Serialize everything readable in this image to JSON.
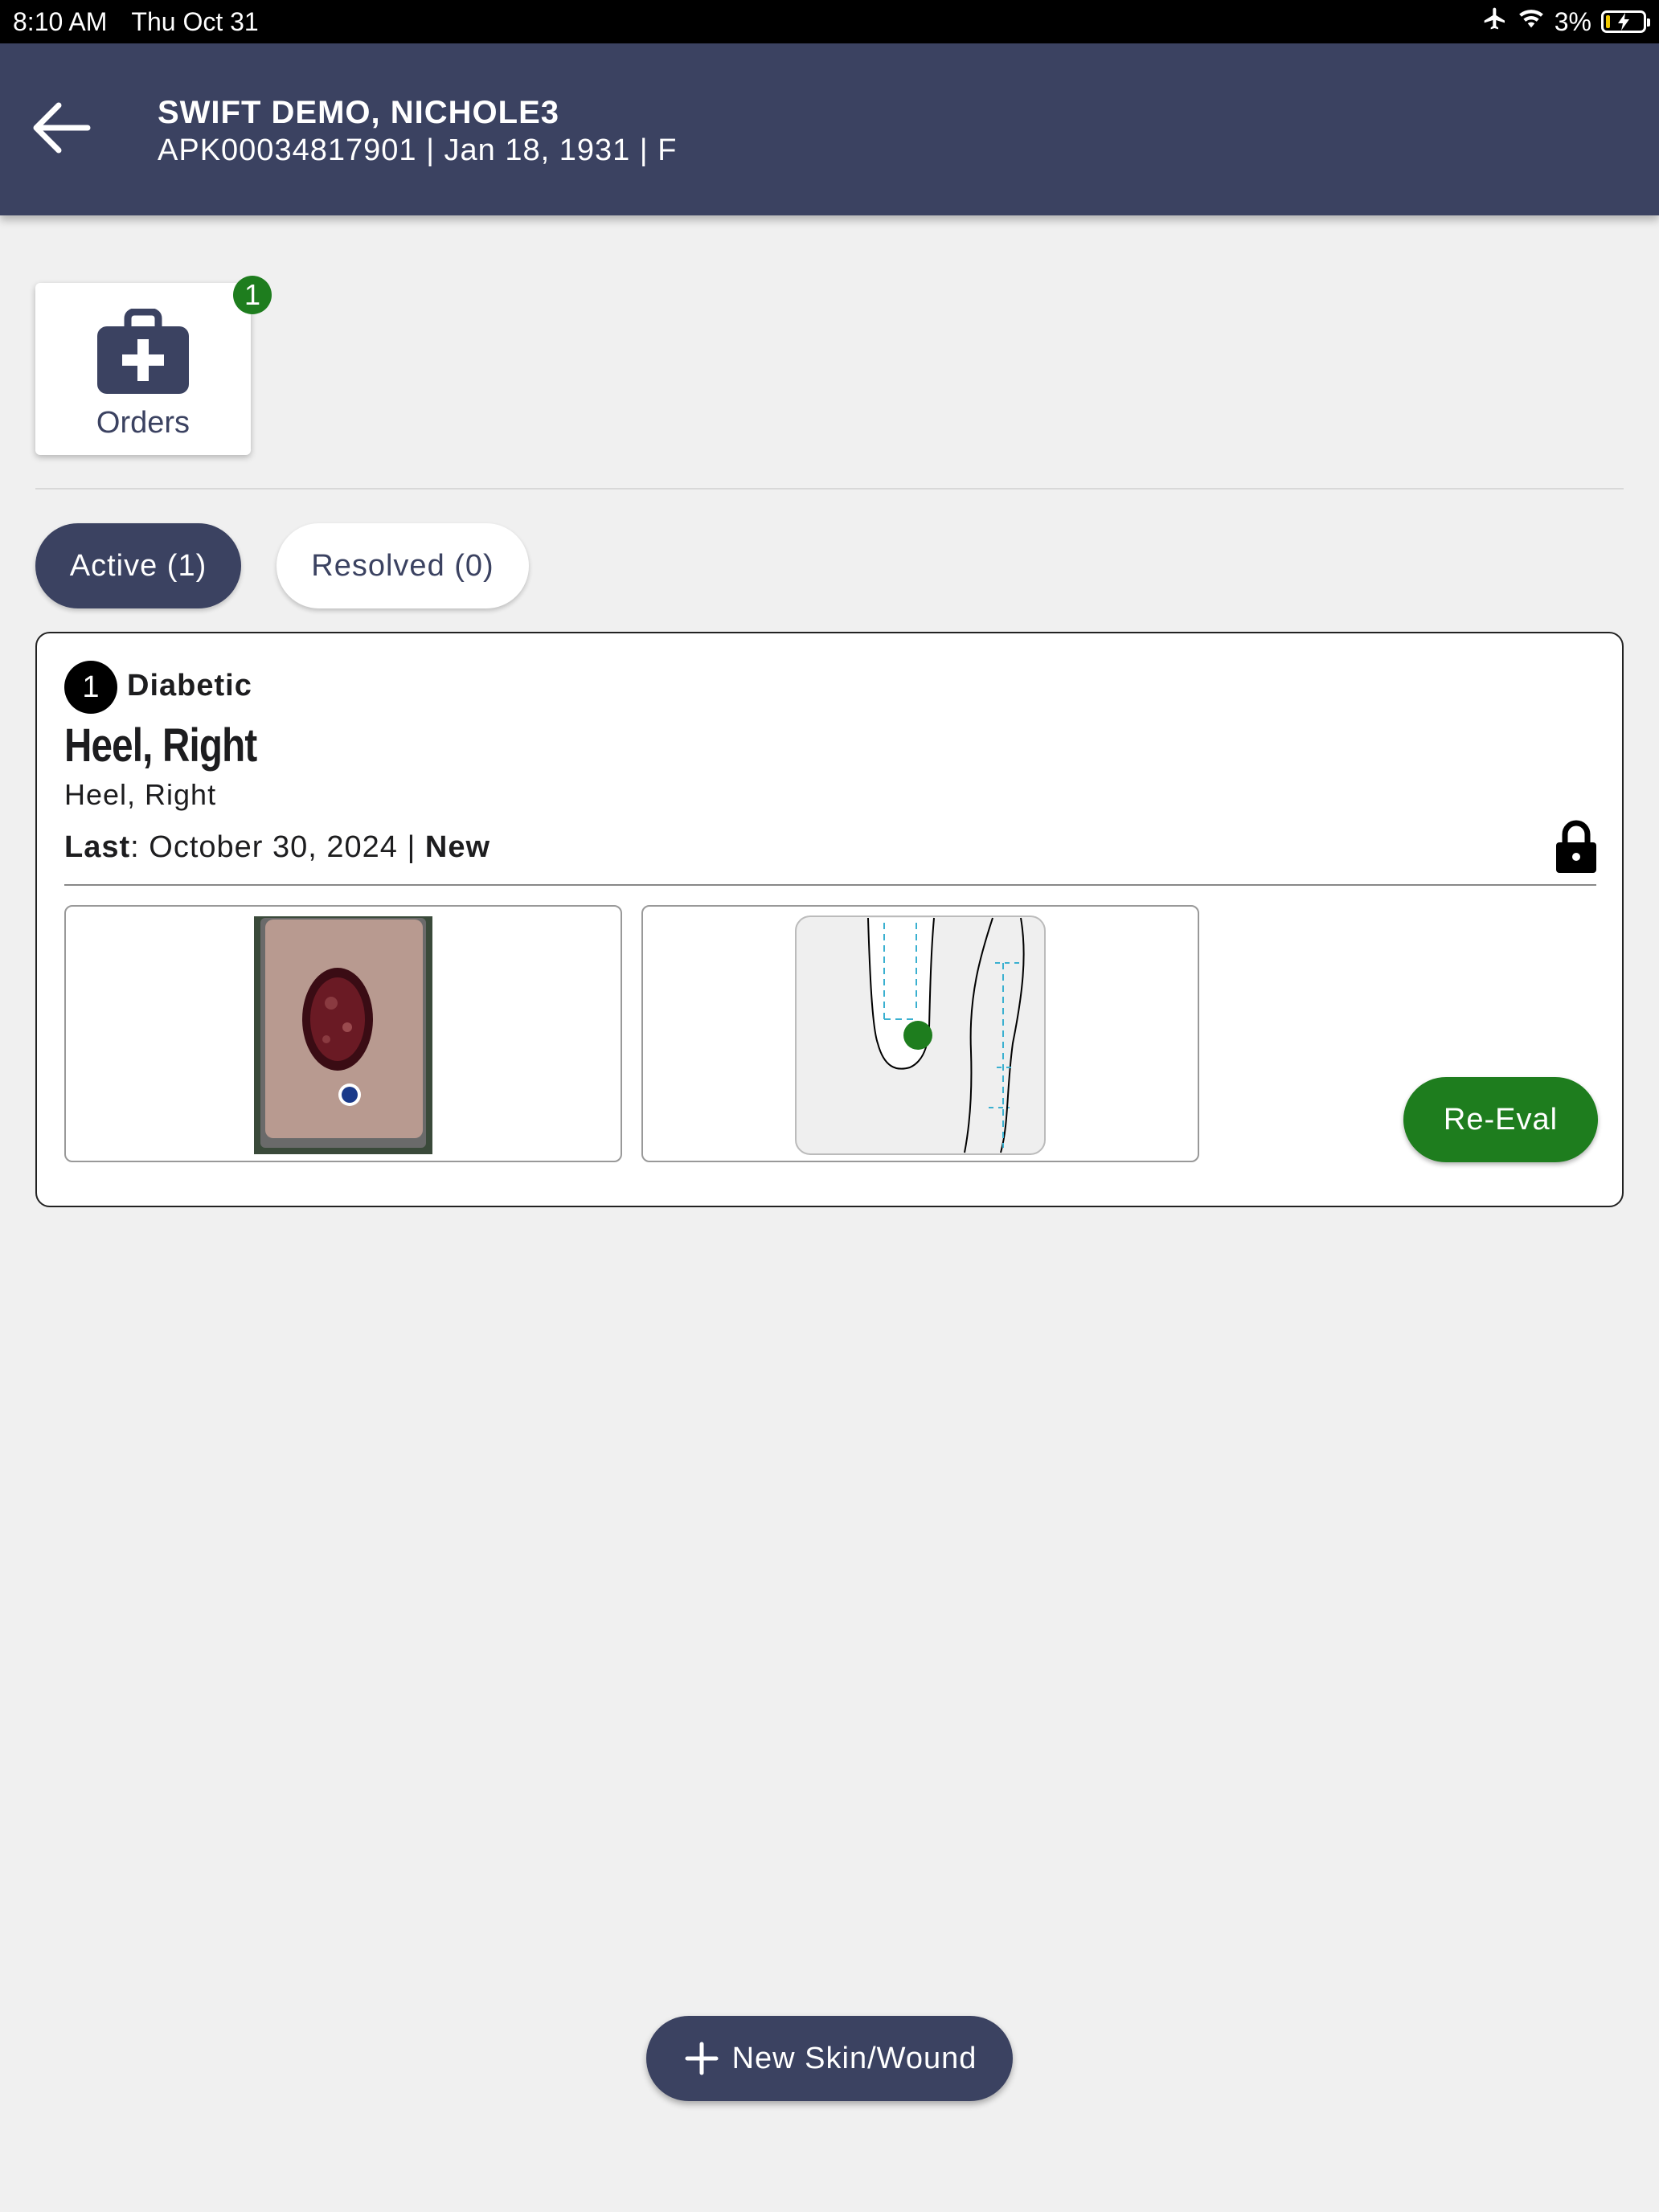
{
  "status_bar": {
    "time": "8:10 AM",
    "date": "Thu Oct 31",
    "battery": "3%",
    "icons": [
      "airplane-icon",
      "wifi-icon",
      "battery-charging-icon"
    ]
  },
  "header": {
    "patient_name": "SWIFT DEMO, NICHOLE3",
    "patient_meta": "APK00034817901 | Jan 18, 1931 | F",
    "colors": {
      "header_bg": "#3b4261"
    }
  },
  "orders": {
    "label": "Orders",
    "badge": "1"
  },
  "tabs": [
    {
      "label": "Active (1)",
      "selected": true
    },
    {
      "label": "Resolved (0)",
      "selected": false
    }
  ],
  "wound": {
    "number": "1",
    "type": "Diabetic",
    "title": "Heel, Right",
    "subtitle": "Heel, Right",
    "last_label": "Last",
    "last_date": ": October 30, 2024 | ",
    "status": "New",
    "reeval_label": "Re-Eval"
  },
  "new_wound_label": "New Skin/Wound",
  "colors": {
    "primary": "#3b4261",
    "success": "#1e7d1e",
    "background": "#f0f0f0"
  }
}
